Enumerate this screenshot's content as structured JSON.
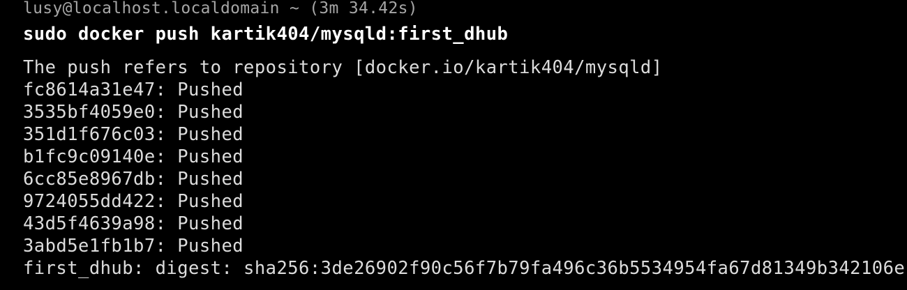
{
  "theme": {
    "background": "#000000",
    "header_color": "#a6a6a6",
    "command_color": "#ffffff",
    "output_color": "#dcdcdc"
  },
  "header": {
    "user_host": "lusy@localhost.localdomain",
    "path": "~",
    "duration": "(3m 34.42s)",
    "text": "lusy@localhost.localdomain ~ (3m 34.42s)"
  },
  "command": {
    "text": "sudo docker push kartik404/mysqld:first_dhub"
  },
  "output": {
    "push_ref": "The push refers to repository [docker.io/kartik404/mysqld]",
    "layers": [
      {
        "id": "fc8614a31e47",
        "status": "Pushed",
        "text": "fc8614a31e47: Pushed"
      },
      {
        "id": "3535bf4059e0",
        "status": "Pushed",
        "text": "3535bf4059e0: Pushed"
      },
      {
        "id": "351d1f676c03",
        "status": "Pushed",
        "text": "351d1f676c03: Pushed"
      },
      {
        "id": "b1fc9c09140e",
        "status": "Pushed",
        "text": "b1fc9c09140e: Pushed"
      },
      {
        "id": "6cc85e8967db",
        "status": "Pushed",
        "text": "6cc85e8967db: Pushed"
      },
      {
        "id": "9724055dd422",
        "status": "Pushed",
        "text": "9724055dd422: Pushed"
      },
      {
        "id": "43d5f4639a98",
        "status": "Pushed",
        "text": "43d5f4639a98: Pushed"
      },
      {
        "id": "3abd5e1fb1b7",
        "status": "Pushed",
        "text": "3abd5e1fb1b7: Pushed"
      }
    ],
    "digest_line": "first_dhub: digest: sha256:3de26902f90c56f7b79fa496c36b5534954fa67d81349b342106e"
  }
}
